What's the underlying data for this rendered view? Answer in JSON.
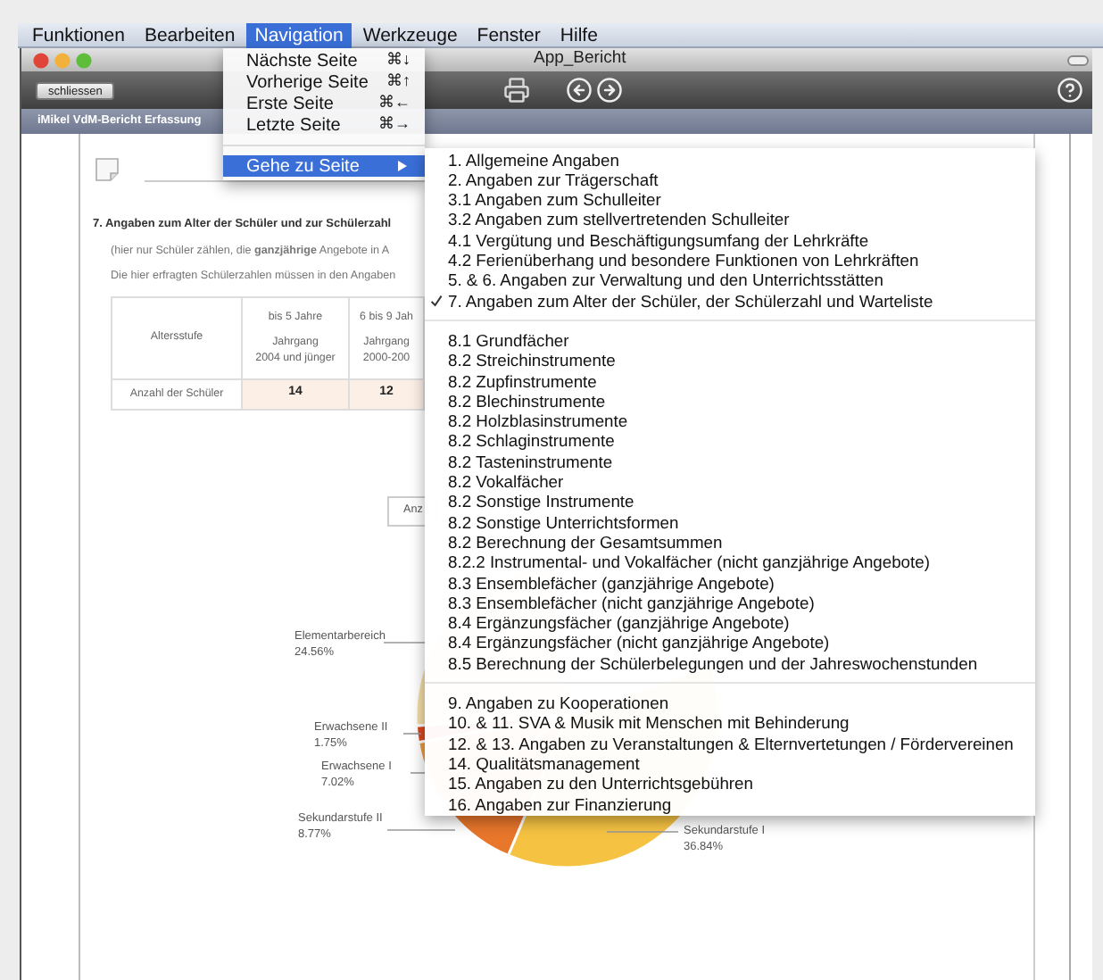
{
  "menubar": [
    {
      "label": "Funktionen",
      "selected": false
    },
    {
      "label": "Bearbeiten",
      "selected": false
    },
    {
      "label": "Navigation",
      "selected": true
    },
    {
      "label": "Werkzeuge",
      "selected": false
    },
    {
      "label": "Fenster",
      "selected": false
    },
    {
      "label": "Hilfe",
      "selected": false
    }
  ],
  "navigation_menu": {
    "items": [
      {
        "label": "Nächste Seite",
        "shortcut": "⌘↓"
      },
      {
        "label": "Vorherige Seite",
        "shortcut": "⌘↑"
      },
      {
        "label": "Erste Seite",
        "shortcut": "⌘←"
      },
      {
        "label": "Letzte Seite",
        "shortcut": "⌘→"
      }
    ],
    "submenu_item": {
      "label": "Gehe zu Seite",
      "selected": true
    }
  },
  "page_submenu": {
    "groups": [
      [
        {
          "label": "1. Allgemeine Angaben",
          "checked": false
        },
        {
          "label": "2. Angaben zur Trägerschaft",
          "checked": false
        },
        {
          "label": "3.1 Angaben zum Schulleiter",
          "checked": false
        },
        {
          "label": "3.2 Angaben zum stellvertretenden Schulleiter",
          "checked": false
        },
        {
          "label": "4.1 Vergütung und Beschäftigungsumfang der Lehrkräfte",
          "checked": false
        },
        {
          "label": "4.2 Ferienüberhang und besondere Funktionen von Lehrkräften",
          "checked": false
        },
        {
          "label": "5. & 6. Angaben zur Verwaltung und den Unterrichtsstätten",
          "checked": false
        },
        {
          "label": "7. Angaben zum Alter der Schüler, der Schülerzahl und Warteliste",
          "checked": true
        }
      ],
      [
        {
          "label": "8.1 Grundfächer",
          "checked": false
        },
        {
          "label": "8.2 Streichinstrumente",
          "checked": false
        },
        {
          "label": "8.2 Zupfinstrumente",
          "checked": false
        },
        {
          "label": "8.2 Blechinstrumente",
          "checked": false
        },
        {
          "label": "8.2 Holzblasinstrumente",
          "checked": false
        },
        {
          "label": "8.2 Schlaginstrumente",
          "checked": false
        },
        {
          "label": "8.2 Tasteninstrumente",
          "checked": false
        },
        {
          "label": "8.2 Vokalfächer",
          "checked": false
        },
        {
          "label": "8.2 Sonstige Instrumente",
          "checked": false
        },
        {
          "label": "8.2 Sonstige Unterrichtsformen",
          "checked": false
        },
        {
          "label": "8.2 Berechnung der Gesamtsummen",
          "checked": false
        },
        {
          "label": "8.2.2 Instrumental- und Vokalfächer (nicht ganzjährige Angebote)",
          "checked": false
        },
        {
          "label": "8.3 Ensemblefächer (ganzjährige Angebote)",
          "checked": false
        },
        {
          "label": "8.3 Ensemblefächer (nicht ganzjährige Angebote)",
          "checked": false
        },
        {
          "label": "8.4 Ergänzungsfächer (ganzjährige Angebote)",
          "checked": false
        },
        {
          "label": "8.4 Ergänzungsfächer (nicht ganzjährige Angebote)",
          "checked": false
        },
        {
          "label": "8.5 Berechnung der Schülerbelegungen und der Jahreswochenstunden",
          "checked": false
        }
      ],
      [
        {
          "label": "9. Angaben zu Kooperationen",
          "checked": false
        },
        {
          "label": "10. & 11. SVA & Musik mit Menschen mit Behinderung",
          "checked": false
        },
        {
          "label": "12. & 13. Angaben zu Veranstaltungen & Elternvertetungen / Fördervereinen",
          "checked": false
        },
        {
          "label": "14. Qualitätsmanagement",
          "checked": false
        },
        {
          "label": "15. Angaben zu den Unterrichtsgebühren",
          "checked": false
        },
        {
          "label": "16. Angaben zur Finanzierung",
          "checked": false
        }
      ]
    ]
  },
  "window": {
    "title": "App_Bericht"
  },
  "toolbar": {
    "close_button": "schliessen"
  },
  "breadcrumb": "iMikel VdM-Bericht Erfassung",
  "section": {
    "heading": "7. Angaben zum Alter der Schüler und zur Schülerzahl",
    "notes": [
      "(hier nur Schüler zählen, die **ganzjährige** Angebote in A",
      "Die hier erfragten Schülerzahlen müssen in den Angaben"
    ],
    "table": {
      "corner": "Altersstufe",
      "columns": [
        {
          "range": "bis 5 Jahre",
          "label": "Jahrgang",
          "years": "2004 und jünger"
        },
        {
          "range": "6 bis 9 Jah",
          "label": "Jahrgang",
          "years": "2000-200"
        }
      ],
      "row": {
        "label": "Anzahl der Schüler",
        "values": [
          "14",
          "12"
        ]
      }
    },
    "button": "Anz",
    "chart_data": {
      "type": "pie",
      "categories": [
        "Elementarbereich",
        "Erwachsene II",
        "Erwachsene I",
        "Sekundarstufe II",
        "Sekundarstufe I"
      ],
      "values": [
        24.56,
        1.75,
        7.02,
        8.77,
        36.84
      ],
      "value_labels": [
        "24.56%",
        "1.75%",
        "7.02%",
        "8.77%",
        "36.84%"
      ]
    }
  }
}
